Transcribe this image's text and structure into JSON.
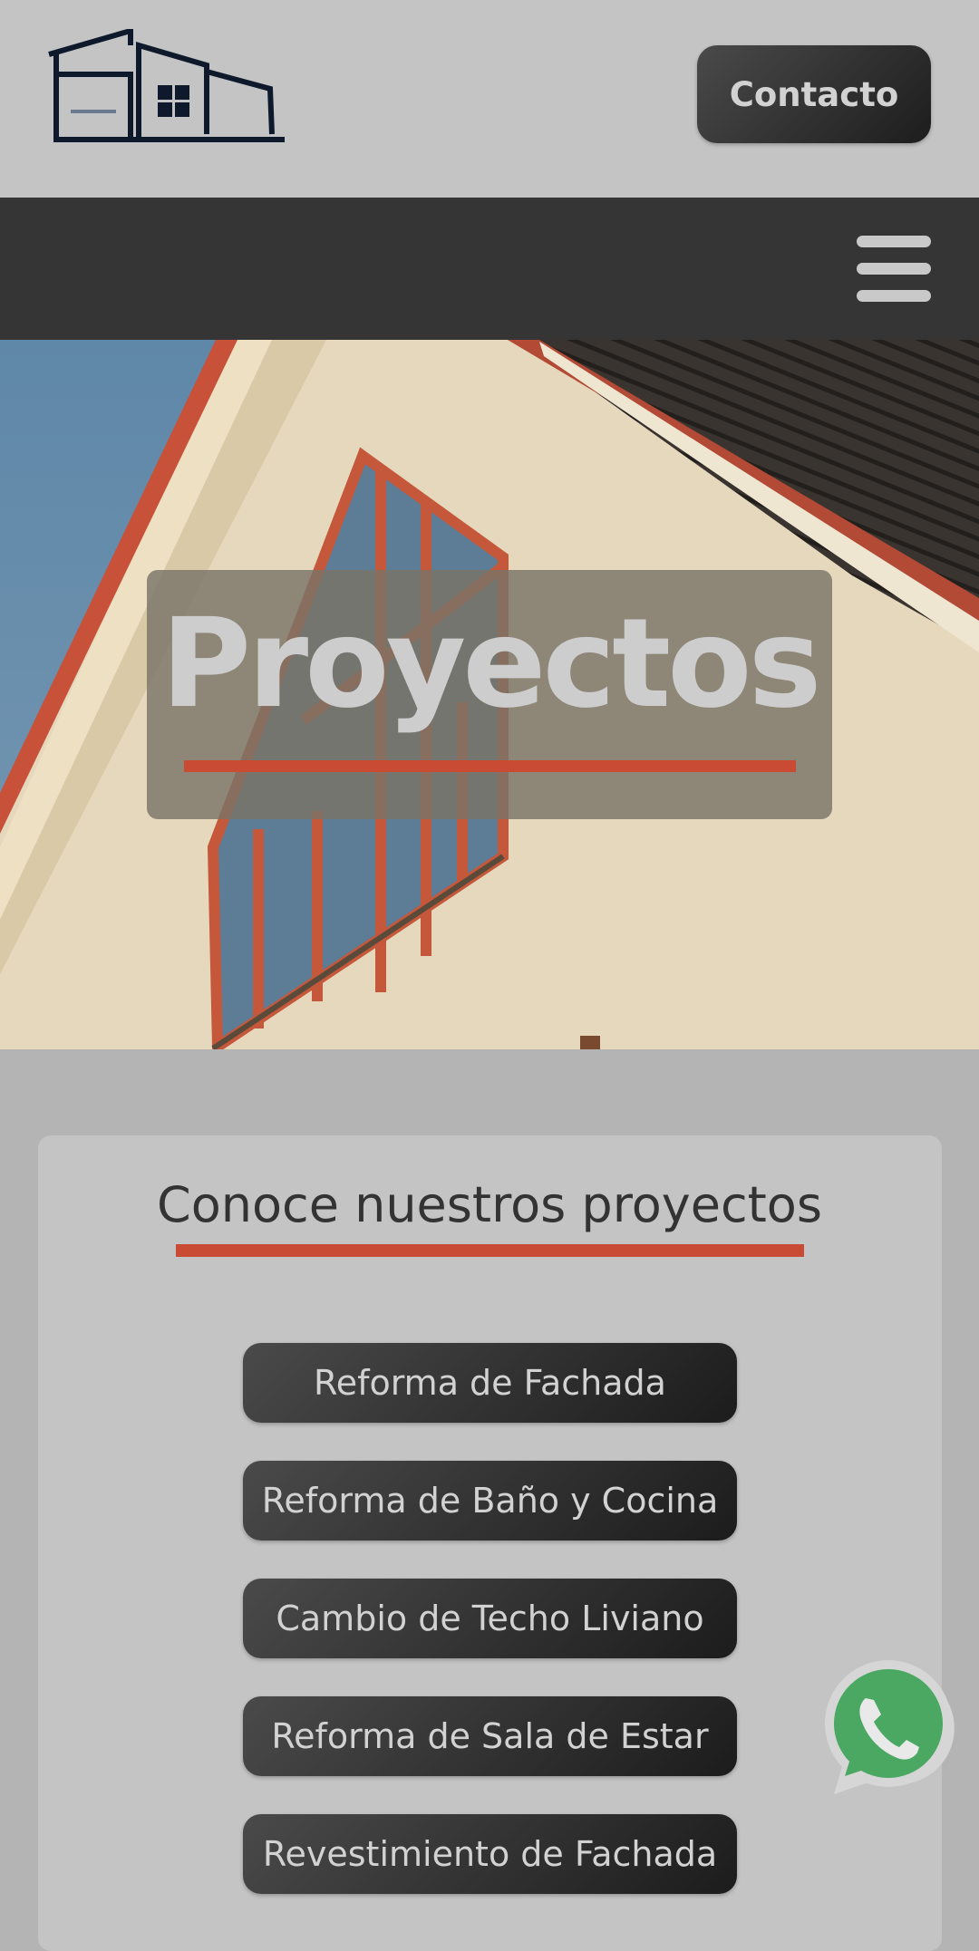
{
  "header": {
    "logo_icon": "house-logo-icon",
    "contact_label": "Contacto"
  },
  "nav": {
    "menu_icon": "hamburger-menu-icon"
  },
  "hero": {
    "title": "Proyectos",
    "image": "house-facade-photo"
  },
  "projects": {
    "title": "Conoce nuestros proyectos",
    "items": [
      {
        "label": "Reforma de Fachada"
      },
      {
        "label": "Reforma de Baño y Cocina"
      },
      {
        "label": "Cambio de Techo Liviano"
      },
      {
        "label": "Reforma de Sala de Estar"
      },
      {
        "label": "Revestimiento de Fachada"
      }
    ]
  },
  "floating": {
    "whatsapp_icon": "whatsapp-icon"
  },
  "colors": {
    "accent": "#c94b33",
    "button_dark": "#2e2e2e",
    "nav_bg": "#353535",
    "header_bg": "#c4c4c4",
    "whatsapp_green": "#4aa862"
  }
}
